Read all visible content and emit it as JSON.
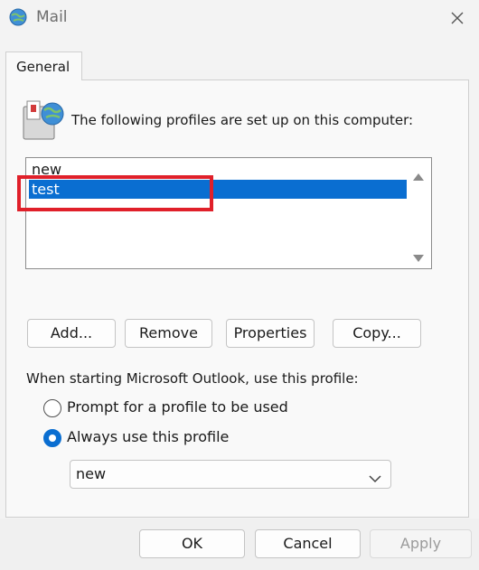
{
  "window": {
    "title": "Mail",
    "close_icon": "close-icon",
    "app_icon": "mail-globe-icon"
  },
  "tabs": [
    {
      "label": "General"
    }
  ],
  "profiles": {
    "heading": "The following profiles are set up on this computer:",
    "icon": "profiles-icon",
    "items": [
      {
        "label": "new",
        "selected": false
      },
      {
        "label": "test",
        "selected": true
      }
    ]
  },
  "buttons": {
    "add": "Add...",
    "remove": "Remove",
    "properties": "Properties",
    "copy": "Copy..."
  },
  "startup": {
    "label": "When starting Microsoft Outlook, use this profile:",
    "prompt_option": "Prompt for a profile to be used",
    "always_option": "Always use this profile",
    "selected_option": "always",
    "selected_profile": "new"
  },
  "footer": {
    "ok": "OK",
    "cancel": "Cancel",
    "apply": "Apply"
  },
  "colors": {
    "accent": "#0a6ed1",
    "annotation": "#e0202a"
  }
}
